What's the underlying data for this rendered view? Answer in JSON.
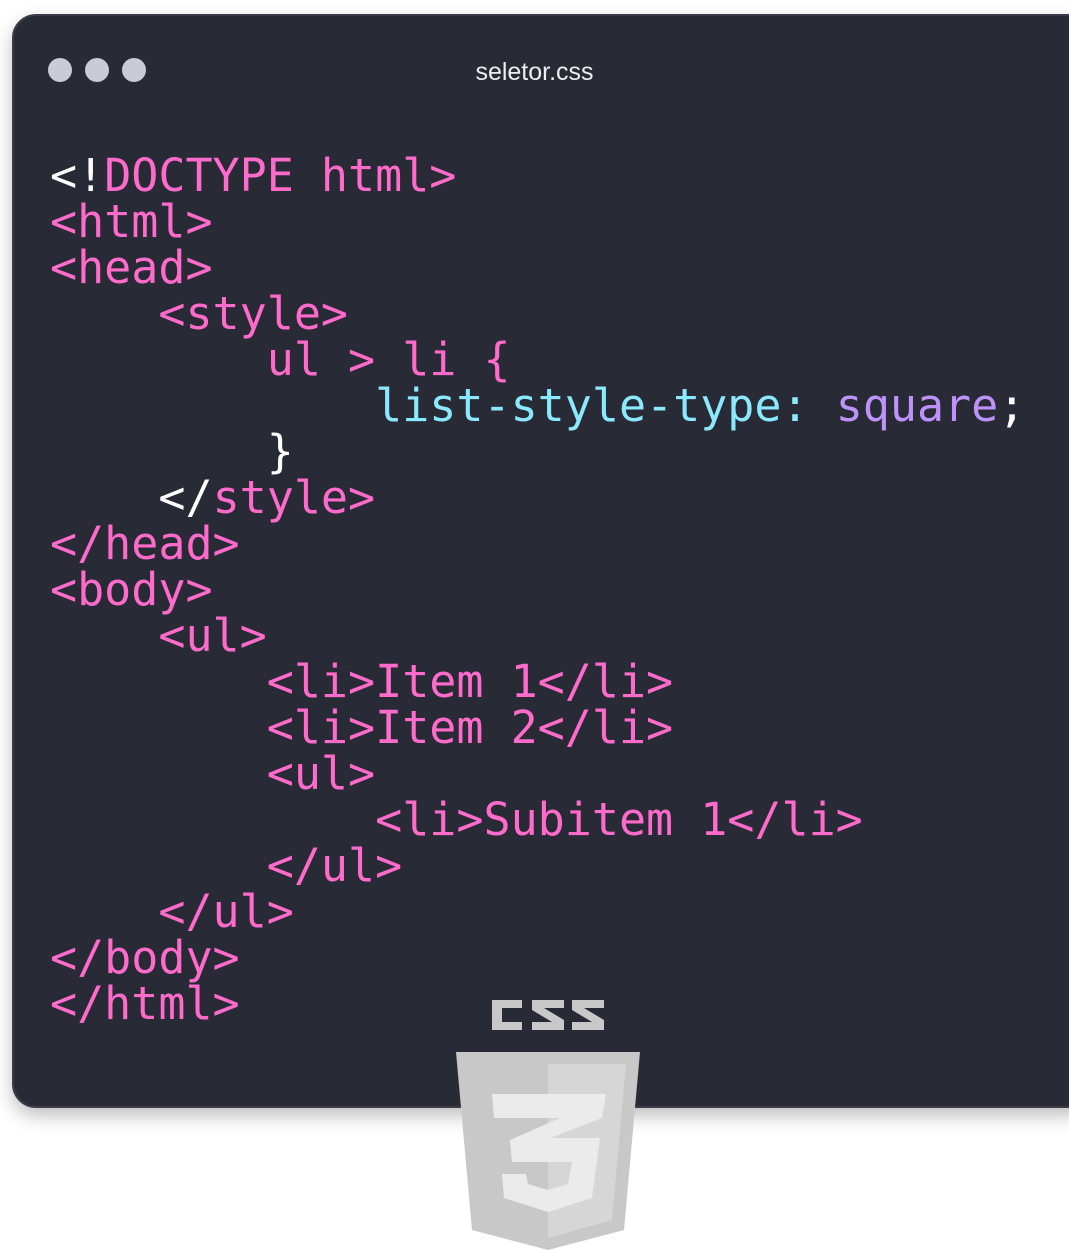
{
  "window": {
    "title": "seletor.css"
  },
  "code_lines": [
    [
      {
        "t": "<!",
        "c": "plain"
      },
      {
        "t": "DOCTYPE html>",
        "c": "tag"
      }
    ],
    [
      {
        "t": "<html>",
        "c": "tag"
      }
    ],
    [
      {
        "t": "<head>",
        "c": "tag"
      }
    ],
    [
      {
        "t": "    <style>",
        "c": "tag"
      }
    ],
    [
      {
        "t": "        ul > li {",
        "c": "tag"
      }
    ],
    [
      {
        "t": "            list-style-type: ",
        "c": "prop"
      },
      {
        "t": "square",
        "c": "val"
      },
      {
        "t": ";",
        "c": "plain"
      }
    ],
    [
      {
        "t": "        }",
        "c": "plain"
      }
    ],
    [
      {
        "t": "    </",
        "c": "plain"
      },
      {
        "t": "style>",
        "c": "tag"
      }
    ],
    [
      {
        "t": "</head>",
        "c": "tag"
      }
    ],
    [
      {
        "t": "<body>",
        "c": "tag"
      }
    ],
    [
      {
        "t": "    <ul>",
        "c": "tag"
      }
    ],
    [
      {
        "t": "        <li>Item 1</li>",
        "c": "tag"
      }
    ],
    [
      {
        "t": "        <li>Item 2</li>",
        "c": "tag"
      }
    ],
    [
      {
        "t": "        <ul>",
        "c": "tag"
      }
    ],
    [
      {
        "t": "            <li>Subitem 1</li>",
        "c": "tag"
      }
    ],
    [
      {
        "t": "        </ul>",
        "c": "tag"
      }
    ],
    [
      {
        "t": "    </ul>",
        "c": "tag"
      }
    ],
    [
      {
        "t": "</body>",
        "c": "tag"
      }
    ],
    [
      {
        "t": "</html>",
        "c": "tag"
      }
    ]
  ],
  "logo": {
    "label": "CSS",
    "version": "3"
  },
  "colors": {
    "background": "#282a36",
    "tag": "#ff6bcb",
    "property": "#8be9fd",
    "value": "#bd93f9",
    "plain": "#ffffff",
    "logo": "#c8c8c8"
  }
}
